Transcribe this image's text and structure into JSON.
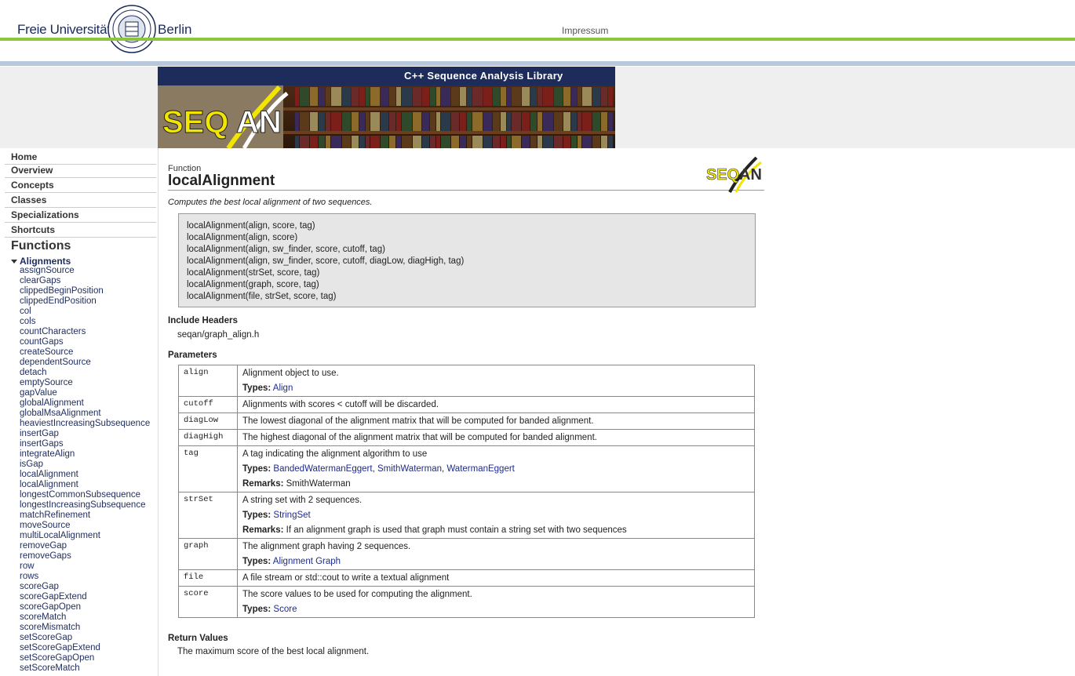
{
  "header": {
    "university_left": "Freie Universität",
    "university_right": "Berlin",
    "impressum": "Impressum"
  },
  "banner": {
    "tagline": "C++ Sequence Analysis Library",
    "logo_text": "SEQAN"
  },
  "nav": {
    "main_items": [
      "Home",
      "Overview",
      "Concepts",
      "Classes",
      "Specializations",
      "Shortcuts"
    ],
    "section_title": "Functions",
    "group_title": "Alignments",
    "items": [
      "assignSource",
      "clearGaps",
      "clippedBeginPosition",
      "clippedEndPosition",
      "col",
      "cols",
      "countCharacters",
      "countGaps",
      "createSource",
      "dependentSource",
      "detach",
      "emptySource",
      "gapValue",
      "globalAlignment",
      "globalMsaAlignment",
      "heaviestIncreasingSubsequence",
      "insertGap",
      "insertGaps",
      "integrateAlign",
      "isGap",
      "localAlignment",
      "localAlignment",
      "longestCommonSubsequence",
      "longestIncreasingSubsequence",
      "matchRefinement",
      "moveSource",
      "multiLocalAlignment",
      "removeGap",
      "removeGaps",
      "row",
      "rows",
      "scoreGap",
      "scoreGapExtend",
      "scoreGapOpen",
      "scoreMatch",
      "scoreMismatch",
      "setScoreGap",
      "setScoreGapExtend",
      "setScoreGapOpen",
      "setScoreMatch"
    ]
  },
  "content": {
    "kind": "Function",
    "name": "localAlignment",
    "description": "Computes the best local alignment of two sequences.",
    "signatures": [
      "localAlignment(align, score, tag)",
      "localAlignment(align, score)",
      "localAlignment(align, sw_finder, score, cutoff, tag)",
      "localAlignment(align, sw_finder, score, cutoff, diagLow, diagHigh, tag)",
      "localAlignment(strSet, score, tag)",
      "localAlignment(graph, score, tag)",
      "localAlignment(file, strSet, score, tag)"
    ],
    "include_heading": "Include Headers",
    "include_value": "seqan/graph_align.h",
    "params_heading": "Parameters",
    "params": [
      {
        "name": "align",
        "desc": "Alignment object to use.",
        "types_label": "Types:",
        "types": [
          "Align"
        ]
      },
      {
        "name": "cutoff",
        "desc": "Alignments with scores < cutoff will be discarded."
      },
      {
        "name": "diagLow",
        "desc": "The lowest diagonal of the alignment matrix that will be computed for banded alignment."
      },
      {
        "name": "diagHigh",
        "desc": "The highest diagonal of the alignment matrix that will be computed for banded alignment."
      },
      {
        "name": "tag",
        "desc": "A tag indicating the alignment algorithm to use",
        "types_label": "Types:",
        "types": [
          "BandedWatermanEggert",
          "SmithWaterman",
          "WatermanEggert"
        ],
        "remarks_label": "Remarks:",
        "remarks": "SmithWaterman"
      },
      {
        "name": "strSet",
        "desc": "A string set with 2 sequences.",
        "types_label": "Types:",
        "types": [
          "StringSet"
        ],
        "remarks_label": "Remarks:",
        "remarks": "If an alignment graph is used that graph must contain a string set with two sequences"
      },
      {
        "name": "graph",
        "desc": "The alignment graph having 2 sequences.",
        "types_label": "Types:",
        "types": [
          "Alignment Graph"
        ]
      },
      {
        "name": "file",
        "desc": "A file stream or std::cout to write a textual alignment"
      },
      {
        "name": "score",
        "desc": "The score values to be used for computing the alignment.",
        "types_label": "Types:",
        "types": [
          "Score"
        ]
      }
    ],
    "return_heading": "Return Values",
    "return_value": "The maximum score of the best local alignment."
  },
  "colors": {
    "green_rule": "#8cc63e",
    "blue_rule": "#b9c7dc",
    "banner_bar": "#1e2c5c",
    "link": "#1e2c8c",
    "seqan_yellow": "#f2e600"
  }
}
